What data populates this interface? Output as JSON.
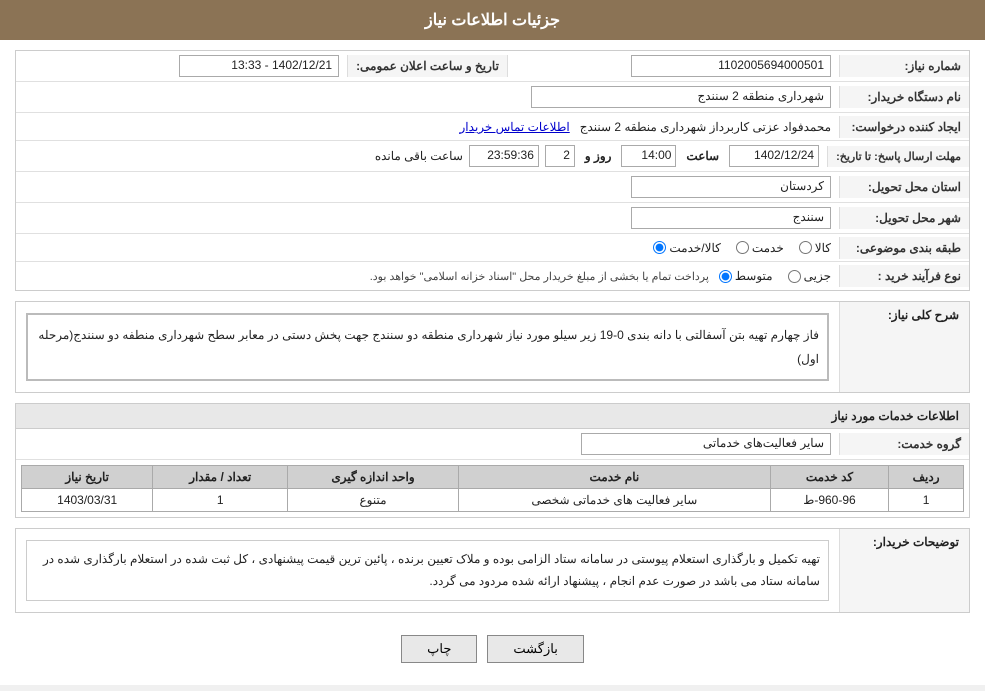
{
  "header": {
    "title": "جزئیات اطلاعات نیاز"
  },
  "form": {
    "shomara_niaz_label": "شماره نیاز:",
    "shomara_niaz_value": "1102005694000501",
    "nam_dastgah_label": "نام دستگاه خریدار:",
    "nam_dastgah_value": "شهرداری منطقه 2 سنندج",
    "tarikh_label": "تاریخ و ساعت اعلان عمومی:",
    "tarikh_value": "1402/12/21 - 13:33",
    "ijad_konandeh_label": "ایجاد کننده درخواست:",
    "ijad_konandeh_value": "محمدفواد عزتی کاربرداز شهرداری منطقه 2 سنندج",
    "ettelaat_tamas_label": "اطلاعات تماس خریدار",
    "mohlat_label": "مهلت ارسال پاسخ: تا تاریخ:",
    "mohlat_date": "1402/12/24",
    "mohlat_saat_label": "ساعت",
    "mohlat_saat_value": "14:00",
    "mohlat_rooz_label": "روز و",
    "mohlat_rooz_value": "2",
    "mohlat_countdown": "23:59:36",
    "mohlat_remaining": "ساعت باقی مانده",
    "ostan_label": "استان محل تحویل:",
    "ostan_value": "کردستان",
    "shahr_label": "شهر محل تحویل:",
    "shahr_value": "سنندج",
    "tabaqeh_label": "طبقه بندی موضوعی:",
    "tabaqeh_options": [
      "کالا",
      "خدمت",
      "کالا/خدمت"
    ],
    "tabaqeh_selected": "کالا",
    "nooe_farayand_label": "نوع فرآیند خرید :",
    "nooe_farayand_options": [
      "جزیی",
      "متوسط"
    ],
    "nooe_farayand_selected": "متوسط",
    "nooe_farayand_note": "پرداخت تمام یا بخشی از مبلغ خریدار محل \"اسناد خزانه اسلامی\" خواهد بود.",
    "sharh_label": "شرح کلی نیاز:",
    "sharh_value": "فاز چهارم تهیه بتن آسفالتی با دانه بندی 0-19 زیر سیلو مورد نیاز شهرداری منطقه دو سنندج جهت پخش دستی در معابر سطح شهرداری منطفه دو سنندج(مرحله اول)",
    "khadamat_label": "اطلاعات خدمات مورد نیاز",
    "goroh_label": "گروه خدمت:",
    "goroh_value": "سایر فعالیت‌های خدماتی",
    "table": {
      "headers": [
        "ردیف",
        "کد خدمت",
        "نام خدمت",
        "واحد اندازه گیری",
        "تعداد / مقدار",
        "تاریخ نیاز"
      ],
      "rows": [
        {
          "radif": "1",
          "kod_khedmat": "960-96-ط",
          "nam_khedmat": "سایر فعالیت های خدماتی شخصی",
          "vahed": "متنوع",
          "tedad": "1",
          "tarikh": "1403/03/31"
        }
      ]
    },
    "tosihaat_label": "توضیحات خریدار:",
    "tosihaat_value": "تهیه  تکمیل و بارگذاری استعلام پیوستی در سامانه ستاد الزامی بوده و ملاک تعیین برنده ، پائین ترین قیمت پیشنهادی ، کل ثبت شده در استعلام بارگذاری شده در سامانه ستاد می باشد در صورت عدم انجام ، پیشنهاد ارائه شده مردود می گردد.",
    "btn_back": "بازگشت",
    "btn_print": "چاپ"
  }
}
